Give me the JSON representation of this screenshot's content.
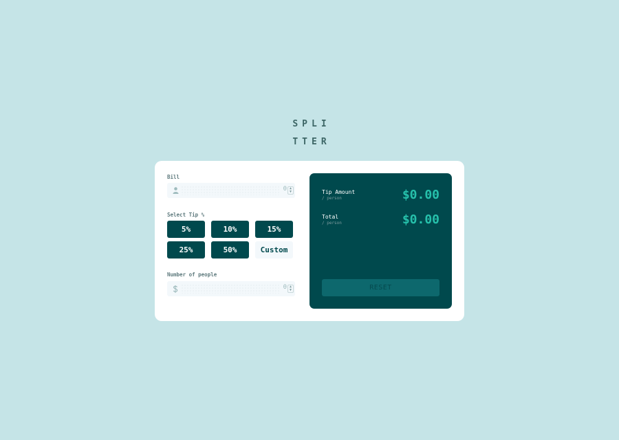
{
  "logo": {
    "line1": "SPLI",
    "line2": "TTER"
  },
  "bill": {
    "label": "Bill",
    "value": "0",
    "icon": "dollar-icon"
  },
  "tip": {
    "label": "Select Tip %",
    "options": [
      "5%",
      "10%",
      "15%",
      "25%",
      "50%"
    ],
    "custom_label": "Custom"
  },
  "people": {
    "label": "Number of people",
    "value": "0",
    "icon": "person-icon"
  },
  "results": {
    "tip_amount": {
      "label": "Tip Amount",
      "sub": "/ person",
      "value": "$0.00"
    },
    "total": {
      "label": "Total",
      "sub": "/ person",
      "value": "$0.00"
    },
    "reset_label": "RESET"
  },
  "colors": {
    "background": "#c5e4e7",
    "dark_cyan": "#00494d",
    "strong_cyan": "#26c0ab",
    "light_grayish_cyan": "#f3f8fb",
    "reset_disabled": "#0d686d"
  }
}
